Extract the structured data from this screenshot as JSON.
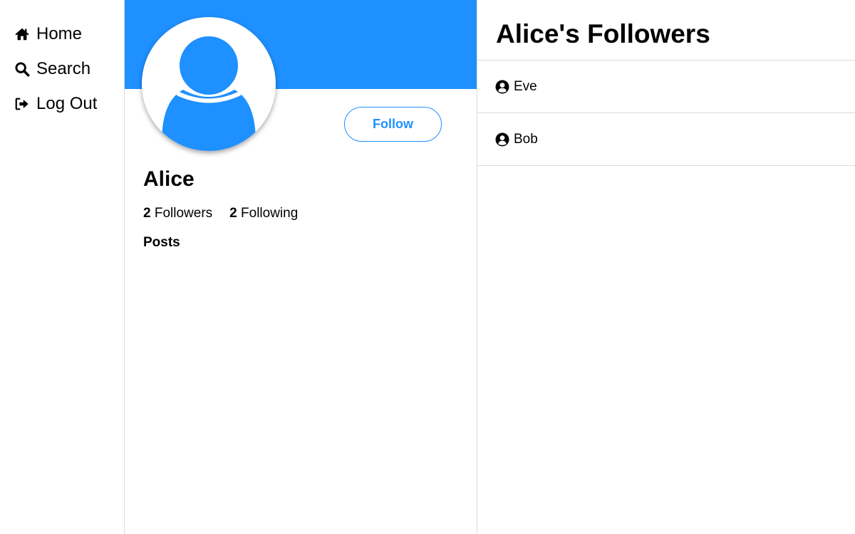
{
  "nav": {
    "items": [
      {
        "label": "Home",
        "icon": "home-icon"
      },
      {
        "label": "Search",
        "icon": "search-icon"
      },
      {
        "label": "Log Out",
        "icon": "logout-icon"
      }
    ]
  },
  "profile": {
    "name": "Alice",
    "follow_label": "Follow",
    "followers_count": "2",
    "followers_label": "Followers",
    "following_count": "2",
    "following_label": "Following",
    "posts_heading": "Posts",
    "banner_color": "#1e90ff",
    "avatar_icon": "user-silhouette-icon"
  },
  "followers_panel": {
    "title": "Alice's Followers",
    "items": [
      {
        "name": "Eve",
        "icon": "user-circle-icon"
      },
      {
        "name": "Bob",
        "icon": "user-circle-icon"
      }
    ]
  },
  "colors": {
    "accent": "#1e90ff",
    "divider": "#dcdcdc"
  }
}
